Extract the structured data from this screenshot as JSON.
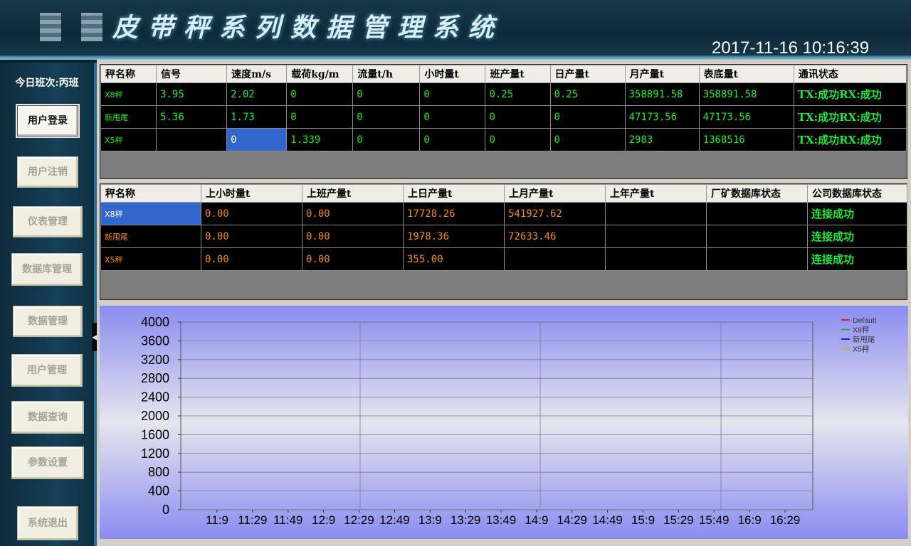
{
  "header": {
    "title": "皮带秤系列数据管理系统",
    "datetime": "2017-11-16 10:16:39"
  },
  "sidebar": {
    "shift": "今日班次:丙班",
    "buttons": [
      "用户登录",
      "用户注销",
      "仪表管理",
      "数据库管理",
      "数据管理",
      "用户管理",
      "数据查询",
      "参数设置",
      "系统退出"
    ]
  },
  "realtime_table": {
    "columns": [
      "秤名称",
      "信号",
      "速度m/s",
      "载荷kg/m",
      "流量t/h",
      "小时量t",
      "班产量t",
      "日产量t",
      "月产量t",
      "表底量t",
      "通讯状态"
    ],
    "rows": [
      [
        "X8秤",
        "3.95",
        "2.02",
        "0",
        "0",
        "0",
        "0.25",
        "0.25",
        "358891.58",
        "358891.58",
        "TX:成功RX:成功"
      ],
      [
        "新甩尾",
        "5.36",
        "1.73",
        "0",
        "0",
        "0",
        "0",
        "0",
        "47173.56",
        "47173.56",
        "TX:成功RX:成功"
      ],
      [
        "X5秤",
        "",
        "0",
        "1.339",
        "0",
        "0",
        "0",
        "0",
        "2983",
        "1368516",
        "TX:成功RX:成功"
      ]
    ]
  },
  "history_table": {
    "columns": [
      "秤名称",
      "上小时量t",
      "上班产量t",
      "上日产量t",
      "上月产量t",
      "上年产量t",
      "厂矿数据库状态",
      "公司数据库状态"
    ],
    "rows": [
      [
        "X8秤",
        "0.00",
        "0.00",
        "17728.26",
        "541927.62",
        "",
        "",
        "连接成功"
      ],
      [
        "新甩尾",
        "0.00",
        "0.00",
        "1978.36",
        "72633.46",
        "",
        "",
        "连接成功"
      ],
      [
        "X5秤",
        "0.00",
        "0.00",
        "355.00",
        "",
        "",
        "",
        "连接成功"
      ]
    ]
  },
  "chart_data": {
    "type": "line",
    "x": [
      "11:9",
      "11:29",
      "11:49",
      "12:9",
      "12:29",
      "12:49",
      "13:9",
      "13:29",
      "13:49",
      "14:9",
      "14:29",
      "14:49",
      "15:9",
      "15:29",
      "15:49",
      "16:9",
      "16:29"
    ],
    "ylim": [
      0,
      4000
    ],
    "yticks": [
      0,
      400,
      800,
      1200,
      1600,
      2000,
      2400,
      2800,
      3200,
      3600,
      4000
    ],
    "grid": true,
    "legend_position": "top-right",
    "series": [
      {
        "name": "Default",
        "color": "#e02020",
        "values": []
      },
      {
        "name": "X8秤",
        "color": "#20b040",
        "values": []
      },
      {
        "name": "新甩尾",
        "color": "#2020c0",
        "values": []
      },
      {
        "name": "X5秤",
        "color": "#c8b020",
        "values": []
      }
    ]
  }
}
